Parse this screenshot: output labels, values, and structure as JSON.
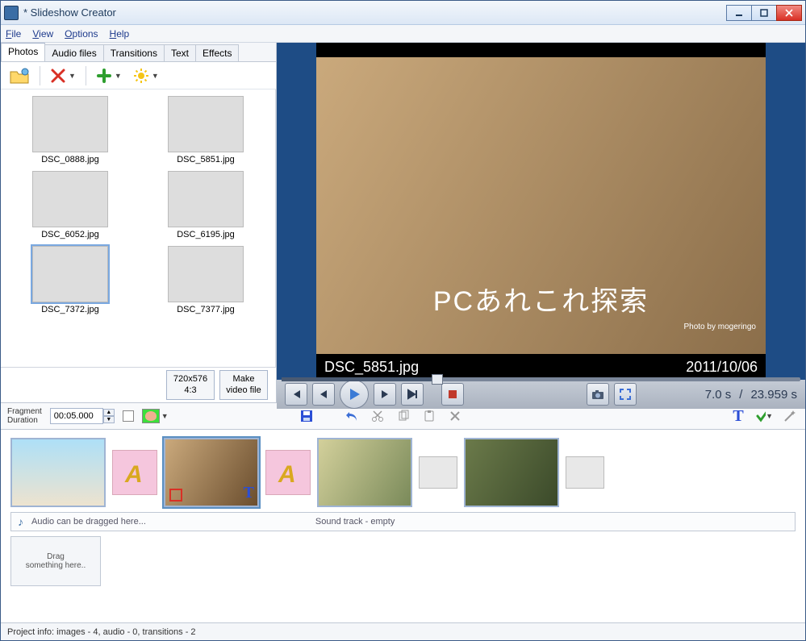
{
  "window": {
    "title": " *  Slideshow Creator"
  },
  "menubar": [
    "File",
    "View",
    "Options",
    "Help"
  ],
  "tabs": [
    "Photos",
    "Audio files",
    "Transitions",
    "Text",
    "Effects"
  ],
  "active_tab": 0,
  "thumbs": [
    {
      "label": "DSC_0888.jpg"
    },
    {
      "label": "DSC_5851.jpg"
    },
    {
      "label": "DSC_6052.jpg"
    },
    {
      "label": "DSC_6195.jpg"
    },
    {
      "label": "DSC_7372.jpg"
    },
    {
      "label": "DSC_7377.jpg"
    }
  ],
  "below": {
    "res": "720x576",
    "aspect": "4:3",
    "make": "Make",
    "make2": "video file"
  },
  "preview": {
    "overlay": "PCあれこれ探索",
    "credit": "Photo by mogeringo",
    "filename": "DSC_5851.jpg",
    "date": "2011/10/06"
  },
  "transport": {
    "pos": "7.0 s",
    "sep": "/",
    "total": "23.959 s"
  },
  "fragment": {
    "label1": "Fragment",
    "label2": "Duration",
    "value": "00:05.000"
  },
  "audio": {
    "hint": "Audio can be dragged here...",
    "status": "Sound track - empty"
  },
  "dragzone": {
    "line1": "Drag",
    "line2": "something here.."
  },
  "status": "Project info: images - 4, audio - 0, transitions - 2"
}
